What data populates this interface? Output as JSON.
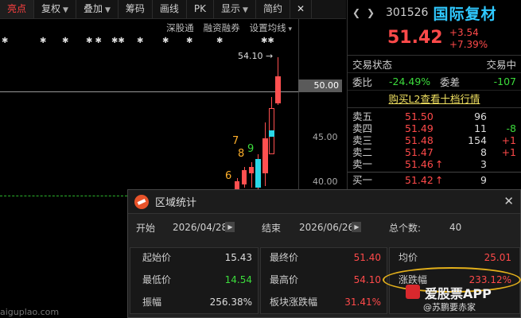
{
  "toolbar": {
    "items": [
      {
        "label": "亮点",
        "active": true
      },
      {
        "label": "复权",
        "dropdown": true
      },
      {
        "label": "叠加",
        "dropdown": true
      },
      {
        "label": "筹码"
      },
      {
        "label": "画线"
      },
      {
        "label": "PK"
      },
      {
        "label": "显示",
        "dropdown": true
      },
      {
        "label": "简约"
      }
    ],
    "close": "✕"
  },
  "chart": {
    "subbar": [
      "深股通",
      "融资融券",
      "设置均线"
    ],
    "high_label": "54.10",
    "current_price_flag": "50.00",
    "yticks": [
      "50.00",
      "45.00",
      "40.00"
    ],
    "digits": [
      {
        "text": "7",
        "color": "#ffb02b"
      },
      {
        "text": "8",
        "color": "#ffb02b"
      },
      {
        "text": "9",
        "color": "#3cdc3c"
      },
      {
        "text": "6",
        "color": "#ffb02b"
      }
    ],
    "colors": {
      "up": "#ff5050",
      "down": "#2ad8e8",
      "grid": "#3a3a3a"
    }
  },
  "quote": {
    "code": "301526",
    "name": "国际复材",
    "price": "51.42",
    "change": "+3.54",
    "change_pct": "+7.39%",
    "status_label": "交易状态",
    "status_value": "交易中",
    "weibi_label": "委比",
    "weibi_value": "-24.49%",
    "weicha_label": "委差",
    "weicha_value": "-107",
    "l2_link": "购买L2查看十档行情",
    "asks": [
      {
        "label": "卖五",
        "price": "51.50",
        "vol": "96",
        "delta": ""
      },
      {
        "label": "卖四",
        "price": "51.49",
        "vol": "11",
        "delta": "-8"
      },
      {
        "label": "卖三",
        "price": "51.48",
        "vol": "154",
        "delta": "+1"
      },
      {
        "label": "卖二",
        "price": "51.47",
        "vol": "8",
        "delta": "+1"
      },
      {
        "label": "卖一",
        "price": "51.46",
        "vol": "3",
        "delta": ""
      }
    ],
    "bids": [
      {
        "label": "买一",
        "price": "51.42",
        "vol": "9",
        "delta": ""
      }
    ]
  },
  "popup": {
    "title": "区域统计",
    "close": "✕",
    "start_label": "开始",
    "start_date": "2026/04/28",
    "end_label": "结束",
    "end_date": "2026/06/26",
    "count_label": "总个数:",
    "count_value": "40",
    "stats": [
      {
        "label": "起始价",
        "value": "15.43",
        "color": "#dddddd"
      },
      {
        "label": "最终价",
        "value": "51.40",
        "color": "#ff4a4a"
      },
      {
        "label": "均价",
        "value": "25.01",
        "color": "#ff4a4a"
      },
      {
        "label": "最低价",
        "value": "14.54",
        "color": "#3cdc3c"
      },
      {
        "label": "最高价",
        "value": "54.10",
        "color": "#ff4a4a"
      },
      {
        "label": "涨跌幅",
        "value": "233.12%",
        "color": "#ff4a4a"
      },
      {
        "label": "振幅",
        "value": "256.38%",
        "color": "#dddddd"
      },
      {
        "label": "板块涨跌幅",
        "value": "31.41%",
        "color": "#ff4a4a"
      }
    ]
  },
  "watermark": {
    "brand": "爱股票APP",
    "sub": "@苏鹏要赤家",
    "url": "aiguplao.com"
  }
}
